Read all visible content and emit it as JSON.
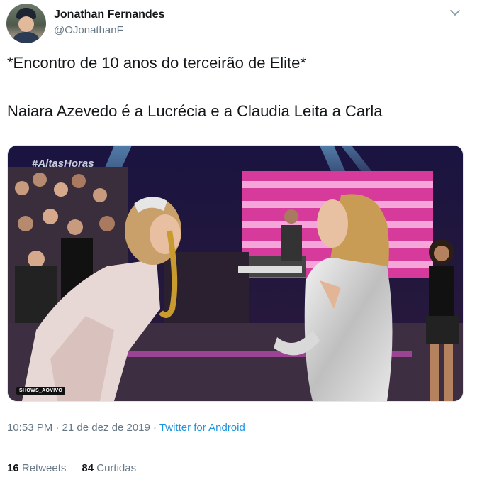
{
  "user": {
    "name": "Jonathan Fernandes",
    "handle": "@OJonathanF"
  },
  "tweet": {
    "line1": "*Encontro de 10 anos do terceirão de Elite*",
    "line2": "Naiara Azevedo é a Lucrécia e a Claudia Leita a Carla"
  },
  "media": {
    "watermark": "#AltasHoras",
    "badge": "SHOWS_AOVIVO"
  },
  "meta": {
    "time": "10:53 PM",
    "separator1": " · ",
    "date": "21 de dez de 2019",
    "separator2": " · ",
    "source": "Twitter for Android"
  },
  "stats": {
    "retweets_count": "16",
    "retweets_label": "Retweets",
    "likes_count": "84",
    "likes_label": "Curtidas"
  },
  "icons": {
    "menu": "chevron-down-icon"
  },
  "colors": {
    "link": "#1b95e0",
    "secondary_text": "#657786",
    "primary_text": "#14171a"
  }
}
